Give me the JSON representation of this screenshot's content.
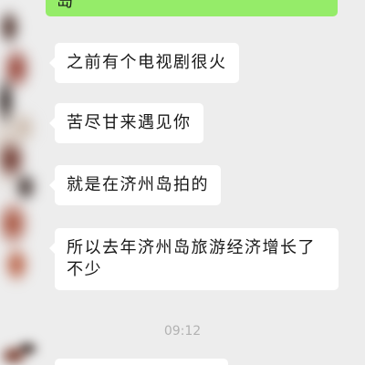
{
  "chat": {
    "top_sent_message": {
      "text": "岛"
    },
    "messages": [
      {
        "text": "之前有个电视剧很火"
      },
      {
        "text": "苦尽甘来遇见你"
      },
      {
        "text": "就是在济州岛拍的"
      },
      {
        "text": "所以去年济州岛旅游经济增长了不少"
      }
    ],
    "timestamp": "09:12"
  },
  "colors": {
    "background": "#ededed",
    "received_bubble": "#ffffff",
    "sent_bubble": "#95ec69",
    "message_text": "#191919",
    "timestamp_text": "#b2b2b2"
  },
  "icons": {
    "avatar": "redacted-avatar"
  }
}
